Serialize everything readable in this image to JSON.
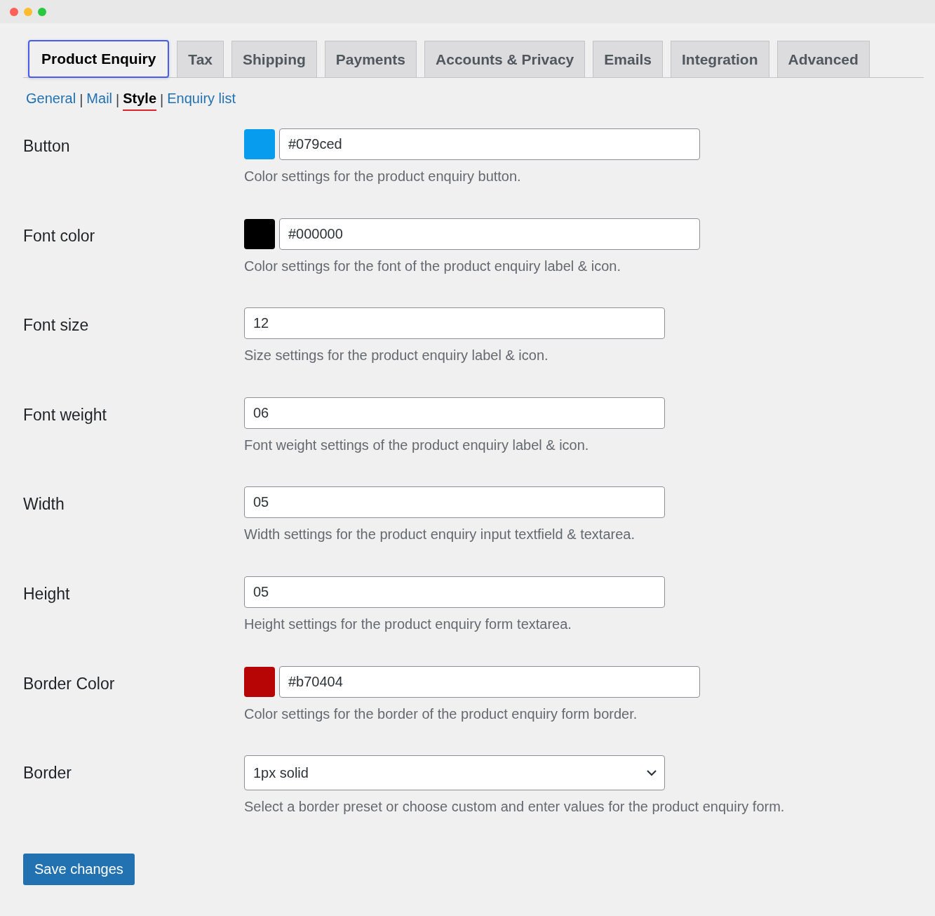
{
  "tabs": [
    {
      "label": "Product Enquiry",
      "selected": true
    },
    {
      "label": "Tax",
      "selected": false
    },
    {
      "label": "Shipping",
      "selected": false
    },
    {
      "label": "Payments",
      "selected": false
    },
    {
      "label": "Accounts & Privacy",
      "selected": false
    },
    {
      "label": "Emails",
      "selected": false
    },
    {
      "label": "Integration",
      "selected": false
    },
    {
      "label": "Advanced",
      "selected": false
    }
  ],
  "subnav": {
    "separator": "|",
    "items": [
      {
        "label": "General",
        "selected": false
      },
      {
        "label": "Mail",
        "selected": false
      },
      {
        "label": "Style",
        "selected": true
      },
      {
        "label": "Enquiry list",
        "selected": false
      }
    ]
  },
  "settings": [
    {
      "kind": "color",
      "label": "Button",
      "value": "#079ced",
      "color": "#079ced",
      "description": "Color settings for the product enquiry button."
    },
    {
      "kind": "color",
      "label": "Font color",
      "value": "#000000",
      "color": "#000000",
      "description": "Color settings for the font of the product enquiry label & icon."
    },
    {
      "kind": "text",
      "label": "Font size",
      "value": "12",
      "description": "Size settings for the product enquiry label & icon."
    },
    {
      "kind": "text",
      "label": "Font weight",
      "value": "06",
      "description": "Font weight settings of the product enquiry label & icon."
    },
    {
      "kind": "text",
      "label": "Width",
      "value": "05",
      "description": "Width settings for the product enquiry input textfield & textarea."
    },
    {
      "kind": "text",
      "label": "Height",
      "value": "05",
      "description": "Height settings for the product enquiry form textarea."
    },
    {
      "kind": "color",
      "label": "Border Color",
      "value": "#b70404",
      "color": "#b70404",
      "description": "Color settings for the border of the product enquiry form border."
    },
    {
      "kind": "select",
      "label": "Border",
      "value": "1px solid",
      "description": "Select a border preset or choose custom and enter values for the product enquiry form."
    }
  ],
  "save_button": "Save changes"
}
